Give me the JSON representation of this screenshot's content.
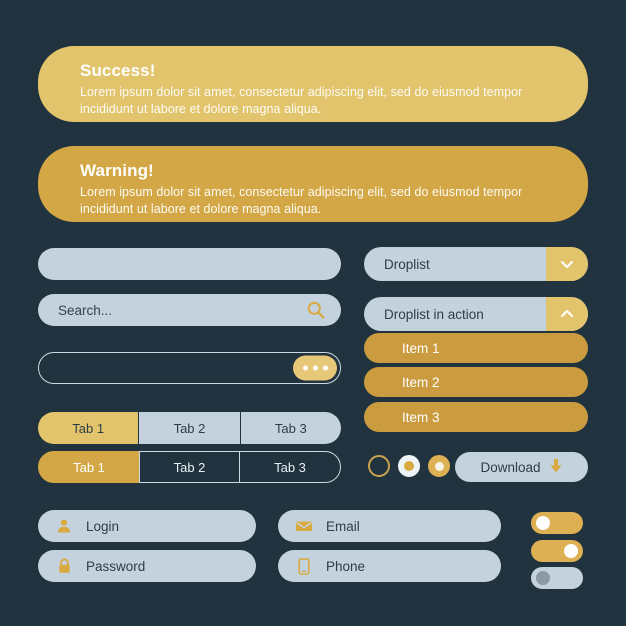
{
  "theme": {
    "background": "#21333f",
    "success_gold": "#e2c46d",
    "warning_gold": "#d3a745",
    "item_gold": "#ca9c3f",
    "light_blue": "#c3d2dc",
    "dark_text": "#2f3d47",
    "white_text": "#ffffff"
  },
  "alerts": [
    {
      "name": "success",
      "title": "Success!",
      "body": "Lorem ipsum dolor sit amet, consectetur adipiscing elit, sed do eiusmod tempor incididunt ut labore et dolore magna aliqua."
    },
    {
      "name": "warning",
      "title": "Warning!",
      "body": "Lorem ipsum dolor sit amet, consectetur adipiscing elit, sed do eiusmod tempor incididunt ut labore et dolore magna aliqua."
    }
  ],
  "inputs": {
    "plain": {
      "value": "",
      "placeholder": ""
    },
    "search": {
      "value": "",
      "placeholder": "Search...",
      "icon": "search-icon"
    },
    "outlined": {
      "value": "",
      "placeholder": "",
      "action_icon": "ellipsis-icon"
    }
  },
  "droplists": [
    {
      "name": "droplist-closed",
      "label": "Droplist",
      "expanded": false,
      "chevron": "chevron-down-icon",
      "items": []
    },
    {
      "name": "droplist-open",
      "label": "Droplist in action",
      "expanded": true,
      "chevron": "chevron-up-icon",
      "items": [
        "Item 1",
        "Item 2",
        "Item 3"
      ]
    }
  ],
  "tab_rows": [
    {
      "name": "tab-row-filled",
      "tabs": [
        {
          "label": "Tab 1",
          "active": true
        },
        {
          "label": "Tab 2",
          "active": false
        },
        {
          "label": "Tab 3",
          "active": false
        }
      ]
    },
    {
      "name": "tab-row-outlined",
      "tabs": [
        {
          "label": "Tab 1",
          "active": true
        },
        {
          "label": "Tab 2",
          "active": false
        },
        {
          "label": "Tab 3",
          "active": false
        }
      ]
    }
  ],
  "radios": [
    {
      "name": "radio-empty",
      "selected": false
    },
    {
      "name": "radio-white",
      "selected": true
    },
    {
      "name": "radio-gold",
      "selected": true
    }
  ],
  "download": {
    "label": "Download",
    "icon": "download-arrow-icon"
  },
  "fields": [
    {
      "name": "login",
      "label": "Login",
      "icon": "user-icon",
      "value": ""
    },
    {
      "name": "password",
      "label": "Password",
      "icon": "lock-icon",
      "value": ""
    },
    {
      "name": "email",
      "label": "Email",
      "icon": "envelope-icon",
      "value": ""
    },
    {
      "name": "phone",
      "label": "Phone",
      "icon": "phone-icon",
      "value": ""
    }
  ],
  "toggles": [
    {
      "name": "toggle-gold-off",
      "on": false,
      "color": "#dcb053"
    },
    {
      "name": "toggle-gold-on",
      "on": true,
      "color": "#dcb053"
    },
    {
      "name": "toggle-muted",
      "on": false,
      "color": "#c3d2dc"
    }
  ]
}
